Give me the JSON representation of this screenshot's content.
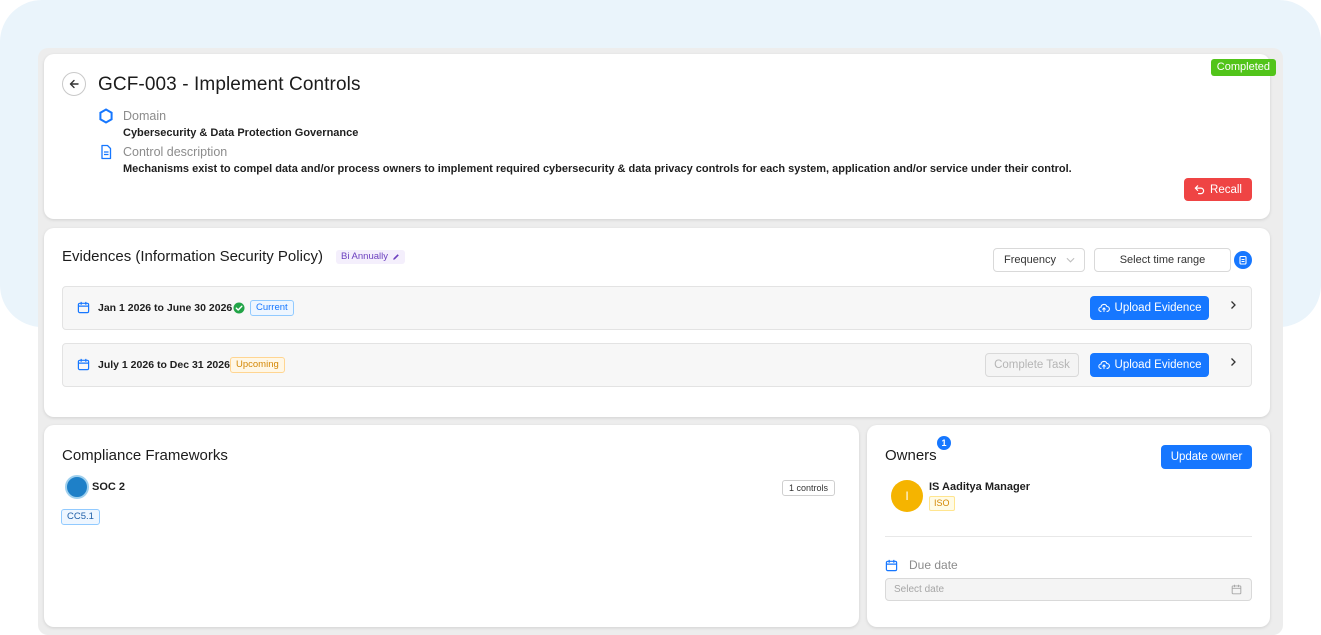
{
  "header": {
    "title": "GCF-003 - Implement Controls",
    "status": "Completed",
    "domain_label": "Domain",
    "domain_value": "Cybersecurity & Data Protection Governance",
    "description_label": "Control description",
    "description_value": "Mechanisms exist to compel data and/or process owners to implement required cybersecurity & data privacy controls for each system, application and/or service under their control.",
    "recall_label": "Recall"
  },
  "evidences": {
    "title": "Evidences (Information Security Policy)",
    "frequency_badge": "Bi Annually",
    "frequency_select": "Frequency",
    "time_range_placeholder": "Select time range",
    "periods": [
      {
        "label": "Jan 1 2026 to June 30 2026",
        "tag": "Current",
        "upload_label": "Upload Evidence"
      },
      {
        "label": "July 1 2026 to Dec 31 2026",
        "tag": "Upcoming",
        "complete_label": "Complete Task",
        "upload_label": "Upload Evidence"
      }
    ]
  },
  "compliance": {
    "title": "Compliance Frameworks",
    "framework_name": "SOC 2",
    "controls_count": "1 controls",
    "control_tag": "CC5.1"
  },
  "owners": {
    "title": "Owners",
    "count": "1",
    "update_label": "Update owner",
    "owner_initial": "I",
    "owner_name": "IS Aaditya Manager",
    "owner_tag": "ISO",
    "due_label": "Due date",
    "date_placeholder": "Select date"
  },
  "colors": {
    "primary": "#1677ff",
    "danger": "#ef4444",
    "success": "#52c41a",
    "avatar": "#f5b400"
  }
}
